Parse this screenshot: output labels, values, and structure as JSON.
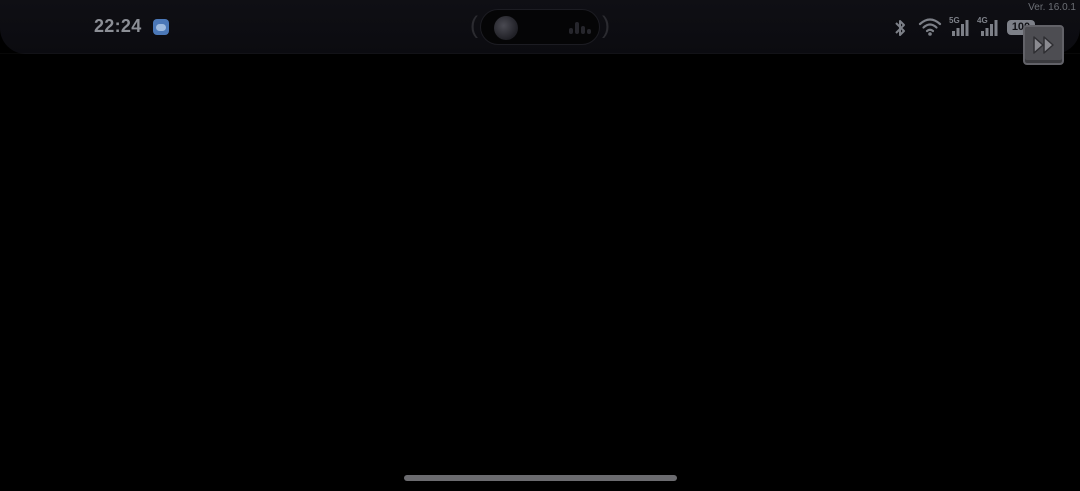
{
  "status_bar": {
    "time": "22:24",
    "network_1": "5G",
    "network_2": "4G",
    "battery_level": "100"
  },
  "overlay": {
    "version": "Ver. 16.0.1"
  },
  "icons": {
    "app_notification": "weather-cloud-icon",
    "bluetooth": "bluetooth-icon",
    "wifi": "wifi-icon",
    "signal": "signal-bars-icon",
    "skip": "fast-forward-icon"
  },
  "colors": {
    "background": "#000000",
    "status_text": "#8c8f96",
    "skip_button": "#4d4d52",
    "home_indicator": "#6b6b6f"
  }
}
